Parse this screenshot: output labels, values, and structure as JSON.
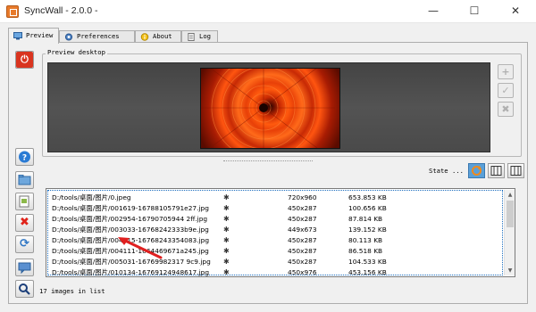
{
  "window": {
    "title": "SyncWall - 2.0.0 -",
    "minimize": "—",
    "maximize": "☐",
    "close": "✕"
  },
  "tabs": [
    {
      "label": "Preview",
      "icon": "monitor-icon"
    },
    {
      "label": "Preferences",
      "icon": "gear-icon"
    },
    {
      "label": "About",
      "icon": "info-icon"
    },
    {
      "label": "Log",
      "icon": "notepad-icon"
    }
  ],
  "preview": {
    "group_label": "Preview desktop",
    "wallpaper_subject": "red dahlia flower"
  },
  "side_buttons": [
    {
      "name": "power-button",
      "icon": "power-icon",
      "glyph": "⏻",
      "color": "#d9341f"
    },
    {
      "name": "help-button",
      "icon": "help-icon",
      "glyph": "?",
      "color": "#2a7bd4"
    },
    {
      "name": "add-folder-button",
      "icon": "folder-icon",
      "glyph": "▤",
      "color": "#3c86c9"
    },
    {
      "name": "add-file-button",
      "icon": "document-icon",
      "glyph": "▢",
      "color": "#6a8c3a"
    },
    {
      "name": "remove-button",
      "icon": "red-x-icon",
      "glyph": "✖",
      "color": "#e0241b"
    },
    {
      "name": "refresh-button",
      "icon": "refresh-icon",
      "glyph": "⟳",
      "color": "#2f76c4"
    },
    {
      "name": "comment-button",
      "icon": "comment-icon",
      "glyph": "▬",
      "color": "#3a6fb0"
    },
    {
      "name": "search-button",
      "icon": "search-icon",
      "glyph": "🔍",
      "color": "#1c3f7a"
    }
  ],
  "desktop_buttons": [
    {
      "name": "add-desktop-button",
      "glyph": "+"
    },
    {
      "name": "apply-desktop-button",
      "glyph": "✓"
    },
    {
      "name": "clear-desktop-button",
      "glyph": "✖"
    }
  ],
  "state": {
    "label": "State ..."
  },
  "images": {
    "rows": [
      {
        "path": "D:/tools/桌面/图片/0.jpeg",
        "dimensions": "720x960",
        "size": "653.853 KB"
      },
      {
        "path": "D:/tools/桌面/图片/001619-16788105791e27.jpg",
        "dimensions": "450x287",
        "size": "100.656 KB"
      },
      {
        "path": "D:/tools/桌面/图片/002954-16790705944 2ff.jpg",
        "dimensions": "450x287",
        "size": "87.814 KB"
      },
      {
        "path": "D:/tools/桌面/图片/003033-16768242333b9e.jpg",
        "dimensions": "449x673",
        "size": "139.152 KB"
      },
      {
        "path": "D:/tools/桌面/图片/004215-16768243354083.jpg",
        "dimensions": "450x287",
        "size": "80.113 KB"
      },
      {
        "path": "D:/tools/桌面/图片/004111-1664469671a245.jpg",
        "dimensions": "450x287",
        "size": "86.518 KB"
      },
      {
        "path": "D:/tools/桌面/图片/005031-16769982317 9c9.jpg",
        "dimensions": "450x287",
        "size": "104.533 KB"
      },
      {
        "path": "D:/tools/桌面/图片/010134-16769124948617.jpg",
        "dimensions": "450x976",
        "size": "453.156 KB"
      }
    ]
  },
  "status": {
    "text": "17 images in list"
  }
}
